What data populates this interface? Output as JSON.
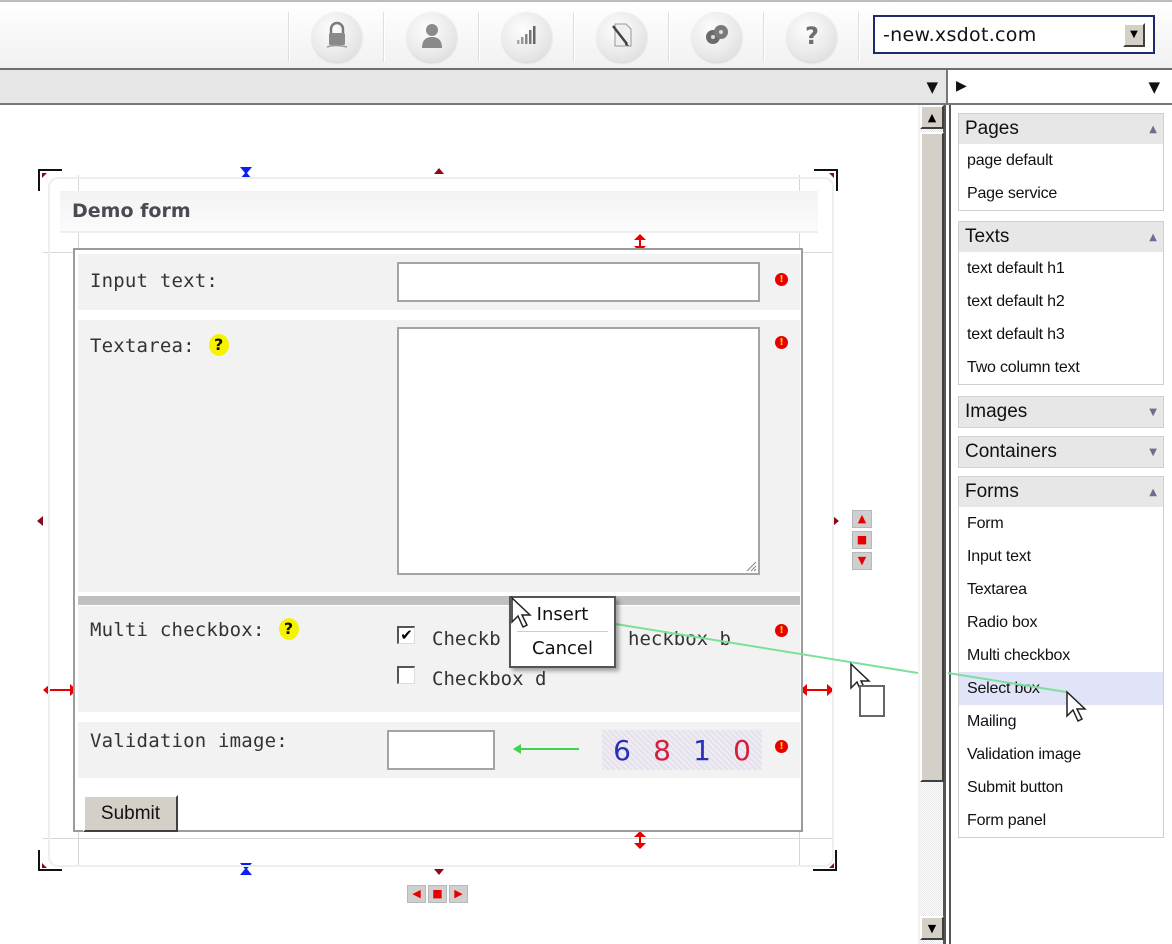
{
  "toolbar": {
    "icons": [
      {
        "name": "lock-icon",
        "label": "Security"
      },
      {
        "name": "user-icon",
        "label": "User"
      },
      {
        "name": "stats-icon",
        "label": "Statistics"
      },
      {
        "name": "edit-document-icon",
        "label": "Edit"
      },
      {
        "name": "film-reels-icon",
        "label": "Media"
      },
      {
        "name": "help-icon",
        "label": "Help"
      }
    ],
    "site_select": {
      "value": "-new.xsdot.com",
      "dropdown_glyph": "▼"
    }
  },
  "subbar": {
    "collapse_glyph": "▼"
  },
  "rightbar": {
    "play_glyph": "▶",
    "collapse_glyph": "▼"
  },
  "scrollbar": {
    "up_glyph": "▲",
    "down_glyph": "▼"
  },
  "panel": {
    "groups": [
      {
        "title": "Pages",
        "expanded": true,
        "toggle": "▲",
        "items": [
          "page default",
          "Page service"
        ]
      },
      {
        "title": "Texts",
        "expanded": true,
        "toggle": "▲",
        "items": [
          "text default h1",
          "text default h2",
          "text default h3",
          "Two column text"
        ]
      },
      {
        "title": "Images",
        "expanded": false,
        "toggle": "▼",
        "items": []
      },
      {
        "title": "Containers",
        "expanded": false,
        "toggle": "▼",
        "items": []
      },
      {
        "title": "Forms",
        "expanded": true,
        "toggle": "▲",
        "items": [
          "Form",
          "Input text",
          "Textarea",
          "Radio box",
          "Multi checkbox",
          "Select box",
          "Mailing",
          "Validation image",
          "Submit button",
          "Form panel"
        ],
        "highlighted": "Select box"
      }
    ]
  },
  "form": {
    "title": "Demo form",
    "fields": {
      "input_text": {
        "label": "Input text:",
        "value": "",
        "required": true
      },
      "textarea": {
        "label": "Textarea:",
        "value": "",
        "required": true,
        "help": "?"
      },
      "multi_checkbox": {
        "label": "Multi checkbox:",
        "help": "?",
        "required": true,
        "options": [
          {
            "label": "Checkbox a",
            "checked": true
          },
          {
            "label": "Checkbox b",
            "checked": false
          },
          {
            "label": "Checkbox d",
            "checked": false
          }
        ],
        "visible_fragments": {
          "a": "Checkb",
          "b": "heckbox b",
          "d": "Checkbox d"
        }
      },
      "validation_image": {
        "label": "Validation image:",
        "value": "",
        "required": true,
        "captcha_digits": [
          "6",
          "8",
          "1",
          "0"
        ],
        "captcha_colors": [
          "#d2203c",
          "#2a2fb8",
          "#d2203c",
          "#2a2fb8"
        ]
      }
    },
    "submit_label": "Submit",
    "required_glyph": "!",
    "checkmark_glyph": "✔"
  },
  "context_menu": {
    "items": [
      "Insert",
      "Cancel"
    ]
  },
  "colors": {
    "required": "#e80000",
    "help": "#f6f300",
    "drag_line": "#7ddf9c",
    "arrow_green": "#3fd44f",
    "handle_blue": "#0b1ff0",
    "handle_red": "#e80000",
    "highlight_row": "#e1e3f8"
  }
}
